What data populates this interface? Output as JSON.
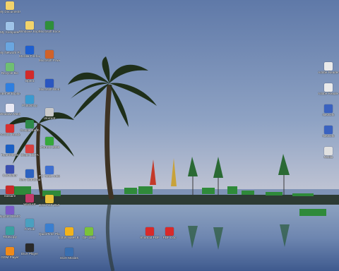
{
  "desktop": {
    "icons_left": [
      {
        "label": "My Documents",
        "icon": "folder-icon",
        "color": "#f2d36b"
      },
      {
        "label": "My Computer",
        "icon": "computer-icon",
        "color": "#9fc3e8"
      },
      {
        "label": "My Network Places",
        "icon": "network-icon",
        "color": "#6aa6e0"
      },
      {
        "label": "Recycle Bin",
        "icon": "recycle-bin-icon",
        "color": "#6fbf73"
      },
      {
        "label": "Internet Explorer",
        "icon": "internet-explorer-icon",
        "color": "#2f7fe0"
      },
      {
        "label": "Windows Media Player",
        "icon": "media-player-icon",
        "color": "#e9e9f4"
      },
      {
        "label": "Acrobat Reader",
        "icon": "acrobat-icon",
        "color": "#d83030"
      },
      {
        "label": "TeamViewer",
        "icon": "teamviewer-icon",
        "color": "#1a5fc4"
      },
      {
        "label": "Calculator",
        "icon": "calculator-icon",
        "color": "#3a4fb0"
      },
      {
        "label": "Solitaire",
        "icon": "cards-icon",
        "color": "#c92a2a"
      },
      {
        "label": "Spybot DEMO",
        "icon": "shield-icon",
        "color": "#7a5ac8"
      },
      {
        "label": "TeraCopy",
        "icon": "copy-icon",
        "color": "#3aa0a0"
      },
      {
        "label": "GOM Player",
        "icon": "gom-player-icon",
        "color": "#f08a1a"
      }
    ],
    "icons_col2": [
      {
        "label": "Windows Explorer",
        "icon": "explorer-icon",
        "color": "#f2d36b"
      },
      {
        "label": "Mozilla Firefox",
        "icon": "firefox-icon",
        "color": "#1e5fd0"
      },
      {
        "label": "Opera",
        "icon": "opera-icon",
        "color": "#d22a2a"
      },
      {
        "label": "Photoshop",
        "icon": "photoshop-icon",
        "color": "#3a9ad0"
      },
      {
        "label": "Google Earth",
        "icon": "globe-icon",
        "color": "#2d8a4a"
      },
      {
        "label": "Skype BETA",
        "icon": "skype-icon",
        "color": "#d84040"
      },
      {
        "label": "Nero StartSmart",
        "icon": "nero-icon",
        "color": "#2c62c0"
      },
      {
        "label": "WinRAR",
        "icon": "archive-icon",
        "color": "#c23a6a"
      },
      {
        "label": "A-Z Lib",
        "icon": "book-icon",
        "color": "#4aa0c0"
      },
      {
        "label": "DivX Player",
        "icon": "divx-icon",
        "color": "#2a2a2a"
      }
    ],
    "icons_col3": [
      {
        "label": "Microsoft Excel 2003",
        "icon": "excel-icon",
        "color": "#2f8f3a"
      },
      {
        "label": "Microsoft PowerPoint",
        "icon": "powerpoint-icon",
        "color": "#d0622a"
      },
      {
        "label": "Microsoft Word 2003",
        "icon": "word-icon",
        "color": "#2a56c0"
      },
      {
        "label": "Utorrent",
        "icon": "torrent-icon",
        "color": "#c9c9c9"
      },
      {
        "label": "uTorrent 2006",
        "icon": "utorrent-icon",
        "color": "#35a83a"
      },
      {
        "label": "PC Tools Antivirus",
        "icon": "antivirus-icon",
        "color": "#3e6fd0"
      },
      {
        "label": "DOCTOR DUI 2005",
        "icon": "doctor-icon",
        "color": "#e9c23a"
      },
      {
        "label": "QuickTime Player",
        "icon": "quicktime-icon",
        "color": "#3a7fd0"
      }
    ],
    "icons_col4": [
      {
        "label": "Lotus Notes 8.5",
        "icon": "lotus-icon",
        "color": "#f2b31a"
      },
      {
        "label": "DivX Movies",
        "icon": "movie-icon",
        "color": "#3a6fb0"
      }
    ],
    "icons_col5": [
      {
        "label": "GIF 2000",
        "icon": "gif-icon",
        "color": "#7ac23a"
      }
    ],
    "icons_mid": [
      {
        "label": "Shortcut PDF",
        "icon": "pdf-icon",
        "color": "#d82a2a"
      },
      {
        "label": "PDF Doc",
        "icon": "pdf-icon",
        "color": "#d82a2a"
      }
    ],
    "icons_right": [
      {
        "label": "Adobe Reader",
        "icon": "reader-icon",
        "color": "#eaeaea"
      },
      {
        "label": "Adobe Reader 8",
        "icon": "reader-icon",
        "color": "#eaeaea"
      },
      {
        "label": "Network",
        "icon": "network-icon",
        "color": "#3a62c0"
      },
      {
        "label": "Network",
        "icon": "network-icon",
        "color": "#3a62c0"
      },
      {
        "label": "Media",
        "icon": "media-icon",
        "color": "#e0e0e0"
      }
    ]
  }
}
